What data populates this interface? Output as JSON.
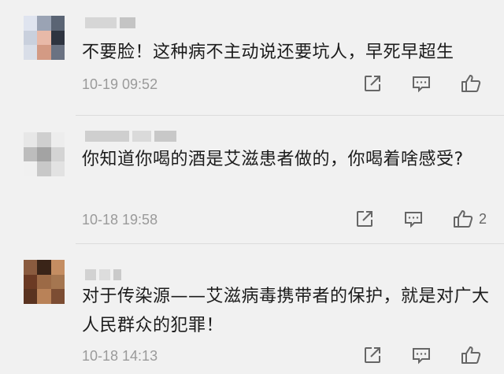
{
  "comments": [
    {
      "text": "不要脸！这种病不主动说还要坑人，早死早超生",
      "time": "10-19 09:52",
      "likes": ""
    },
    {
      "text": "你知道你喝的酒是艾滋患者做的，你喝着啥感受?",
      "time": "10-18 19:58",
      "likes": "2"
    },
    {
      "text": "对于传染源——艾滋病毒携带者的保护，就是对广大人民群众的犯罪！",
      "time": "10-18 14:13",
      "likes": ""
    }
  ],
  "icons": {
    "share": "share-icon",
    "reply": "comment-icon",
    "like": "thumbs-up-icon"
  },
  "colors": {
    "background": "#f1f1f1",
    "text": "#1c1c1c",
    "muted": "#9a9a9a",
    "icon": "#666666"
  }
}
